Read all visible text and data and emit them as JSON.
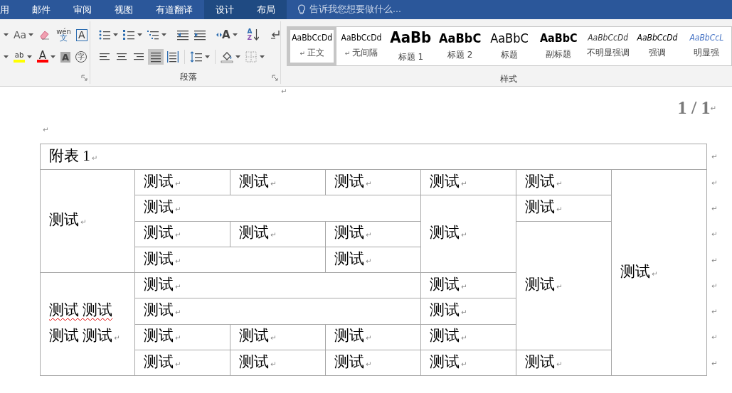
{
  "tabs": [
    {
      "label": "用",
      "contextual": false
    },
    {
      "label": "邮件",
      "contextual": false
    },
    {
      "label": "审阅",
      "contextual": false
    },
    {
      "label": "视图",
      "contextual": false
    },
    {
      "label": "有道翻译",
      "contextual": false
    },
    {
      "label": "设计",
      "contextual": true
    },
    {
      "label": "布局",
      "contextual": true
    }
  ],
  "tell_me": {
    "placeholder": "告诉我您想要做什么..."
  },
  "font_group": {
    "row1": [
      {
        "kind": "caret"
      },
      {
        "kind": "text",
        "label": "Aa",
        "caret": true
      },
      {
        "kind": "eraser"
      },
      {
        "kind": "phonetic",
        "label": "wén",
        "sub": "文"
      },
      {
        "kind": "boxed",
        "label": "A"
      }
    ],
    "row2": [
      {
        "kind": "caret"
      },
      {
        "kind": "color",
        "label": "ab",
        "color": "#ffff00",
        "caret": true
      },
      {
        "kind": "color",
        "label": "A",
        "color": "#ff0000",
        "caret": true
      },
      {
        "kind": "shaded",
        "label": "A"
      },
      {
        "kind": "circled",
        "label": "字"
      }
    ]
  },
  "paragraph_group": {
    "label": "段落",
    "row1": [
      {
        "kind": "bullets",
        "caret": true
      },
      {
        "kind": "numbering",
        "caret": true
      },
      {
        "kind": "multilevel",
        "caret": true
      },
      {
        "kind": "sep"
      },
      {
        "kind": "outdent"
      },
      {
        "kind": "indent"
      },
      {
        "kind": "sep"
      },
      {
        "kind": "asian",
        "label": "A",
        "caret": true
      },
      {
        "kind": "sep"
      },
      {
        "kind": "sort",
        "label": "A",
        "sub": "Z"
      },
      {
        "kind": "sep"
      },
      {
        "kind": "marks"
      }
    ],
    "row2": [
      {
        "kind": "align-left",
        "selected": false
      },
      {
        "kind": "align-center",
        "selected": false
      },
      {
        "kind": "align-right",
        "selected": false
      },
      {
        "kind": "justify",
        "selected": true
      },
      {
        "kind": "distribute",
        "selected": false
      },
      {
        "kind": "sep"
      },
      {
        "kind": "line-spacing",
        "caret": true
      },
      {
        "kind": "sep"
      },
      {
        "kind": "shading",
        "caret": true
      },
      {
        "kind": "borders",
        "caret": true
      }
    ]
  },
  "styles_group": {
    "label": "样式",
    "items": [
      {
        "preview": "AaBbCcDd",
        "name": "正文",
        "kind": "normal",
        "mark": "↵",
        "selected": true
      },
      {
        "preview": "AaBbCcDd",
        "name": "无间隔",
        "kind": "normal",
        "mark": "↵",
        "selected": false
      },
      {
        "preview": "AaBb",
        "name": "标题 1",
        "kind": "heading1",
        "selected": false
      },
      {
        "preview": "AaBbC",
        "name": "标题 2",
        "kind": "heading2",
        "selected": false
      },
      {
        "preview": "AaBbC",
        "name": "标题",
        "kind": "title",
        "selected": false
      },
      {
        "preview": "AaBbC",
        "name": "副标题",
        "kind": "subtitle",
        "selected": false
      },
      {
        "preview": "AaBbCcDd",
        "name": "不明显强调",
        "kind": "subtle",
        "selected": false
      },
      {
        "preview": "AaBbCcDd",
        "name": "强调",
        "kind": "emphasis",
        "selected": false
      },
      {
        "preview": "AaBbCcL",
        "name": "明显强",
        "kind": "intense",
        "selected": false
      }
    ]
  },
  "document": {
    "header_mark": "↵",
    "page_number": "1 / 1",
    "page_number_mark": "↵",
    "para_mark": "↵",
    "table": {
      "title": "附表 1",
      "title_mark": "↵",
      "cells": [
        {
          "lines": [
            {
              "text": "测试",
              "spelling_error": false
            }
          ],
          "mark": "↵"
        },
        {
          "lines": [
            {
              "text": "测试",
              "spelling_error": false
            }
          ],
          "mark": "↵"
        },
        {
          "lines": [
            {
              "text": "测试",
              "spelling_error": false
            }
          ],
          "mark": "↵"
        },
        {
          "lines": [
            {
              "text": "测试",
              "spelling_error": false
            }
          ],
          "mark": "↵"
        },
        {
          "lines": [
            {
              "text": "测试",
              "spelling_error": false
            }
          ],
          "mark": "↵"
        },
        {
          "lines": [
            {
              "text": "测试",
              "spelling_error": false
            }
          ],
          "mark": "↵"
        },
        {
          "lines": [
            {
              "text": "测试",
              "spelling_error": false
            }
          ],
          "mark": "↵"
        },
        {
          "lines": [
            {
              "text": "测试",
              "spelling_error": false
            }
          ],
          "mark": "↵"
        },
        {
          "lines": [
            {
              "text": "测试",
              "spelling_error": false
            }
          ],
          "mark": "↵"
        },
        {
          "lines": [
            {
              "text": "测试",
              "spelling_error": false
            }
          ],
          "mark": "↵"
        },
        {
          "lines": [
            {
              "text": "测试",
              "spelling_error": false
            }
          ],
          "mark": "↵"
        },
        {
          "lines": [
            {
              "text": "测试",
              "spelling_error": false
            }
          ],
          "mark": "↵"
        },
        {
          "lines": [
            {
              "text": "测试",
              "spelling_error": false
            }
          ],
          "mark": "↵"
        },
        {
          "lines": [
            {
              "text": "测试",
              "spelling_error": false
            }
          ],
          "mark": "↵"
        },
        {
          "lines": [
            {
              "text": "测试",
              "spelling_error": false
            }
          ],
          "mark": "↵"
        },
        {
          "lines": [
            {
              "text": "测试",
              "spelling_error": false
            }
          ],
          "mark": "↵"
        },
        {
          "lines": [
            {
              "text": "测试 测试",
              "spelling_error": true
            },
            {
              "text": "测试 测试",
              "spelling_error": false
            }
          ],
          "mark": "↵"
        },
        {
          "lines": [
            {
              "text": "测试",
              "spelling_error": false
            }
          ],
          "mark": "↵"
        },
        {
          "lines": [
            {
              "text": "测试",
              "spelling_error": false
            }
          ],
          "mark": "↵"
        },
        {
          "lines": [
            {
              "text": "测试",
              "spelling_error": false
            }
          ],
          "mark": "↵"
        },
        {
          "lines": [
            {
              "text": "测试",
              "spelling_error": false
            }
          ],
          "mark": "↵"
        },
        {
          "lines": [
            {
              "text": "测试",
              "spelling_error": false
            }
          ],
          "mark": "↵"
        },
        {
          "lines": [
            {
              "text": "测试",
              "spelling_error": false
            }
          ],
          "mark": "↵"
        },
        {
          "lines": [
            {
              "text": "测试",
              "spelling_error": false
            }
          ],
          "mark": "↵"
        },
        {
          "lines": [
            {
              "text": "测试",
              "spelling_error": false
            }
          ],
          "mark": "↵"
        },
        {
          "lines": [
            {
              "text": "测试",
              "spelling_error": false
            }
          ],
          "mark": "↵"
        },
        {
          "lines": [
            {
              "text": "测试",
              "spelling_error": false
            }
          ],
          "mark": "↵"
        },
        {
          "lines": [
            {
              "text": "测试",
              "spelling_error": false
            }
          ],
          "mark": "↵"
        },
        {
          "lines": [
            {
              "text": "测试",
              "spelling_error": false
            }
          ],
          "mark": "↵"
        },
        {
          "lines": [
            {
              "text": "测试",
              "spelling_error": false
            }
          ],
          "mark": "↵"
        }
      ],
      "row_marks": [
        "↵",
        "↵",
        "↵",
        "↵",
        "↵",
        "↵",
        "↵",
        "↵",
        "↵"
      ]
    }
  }
}
